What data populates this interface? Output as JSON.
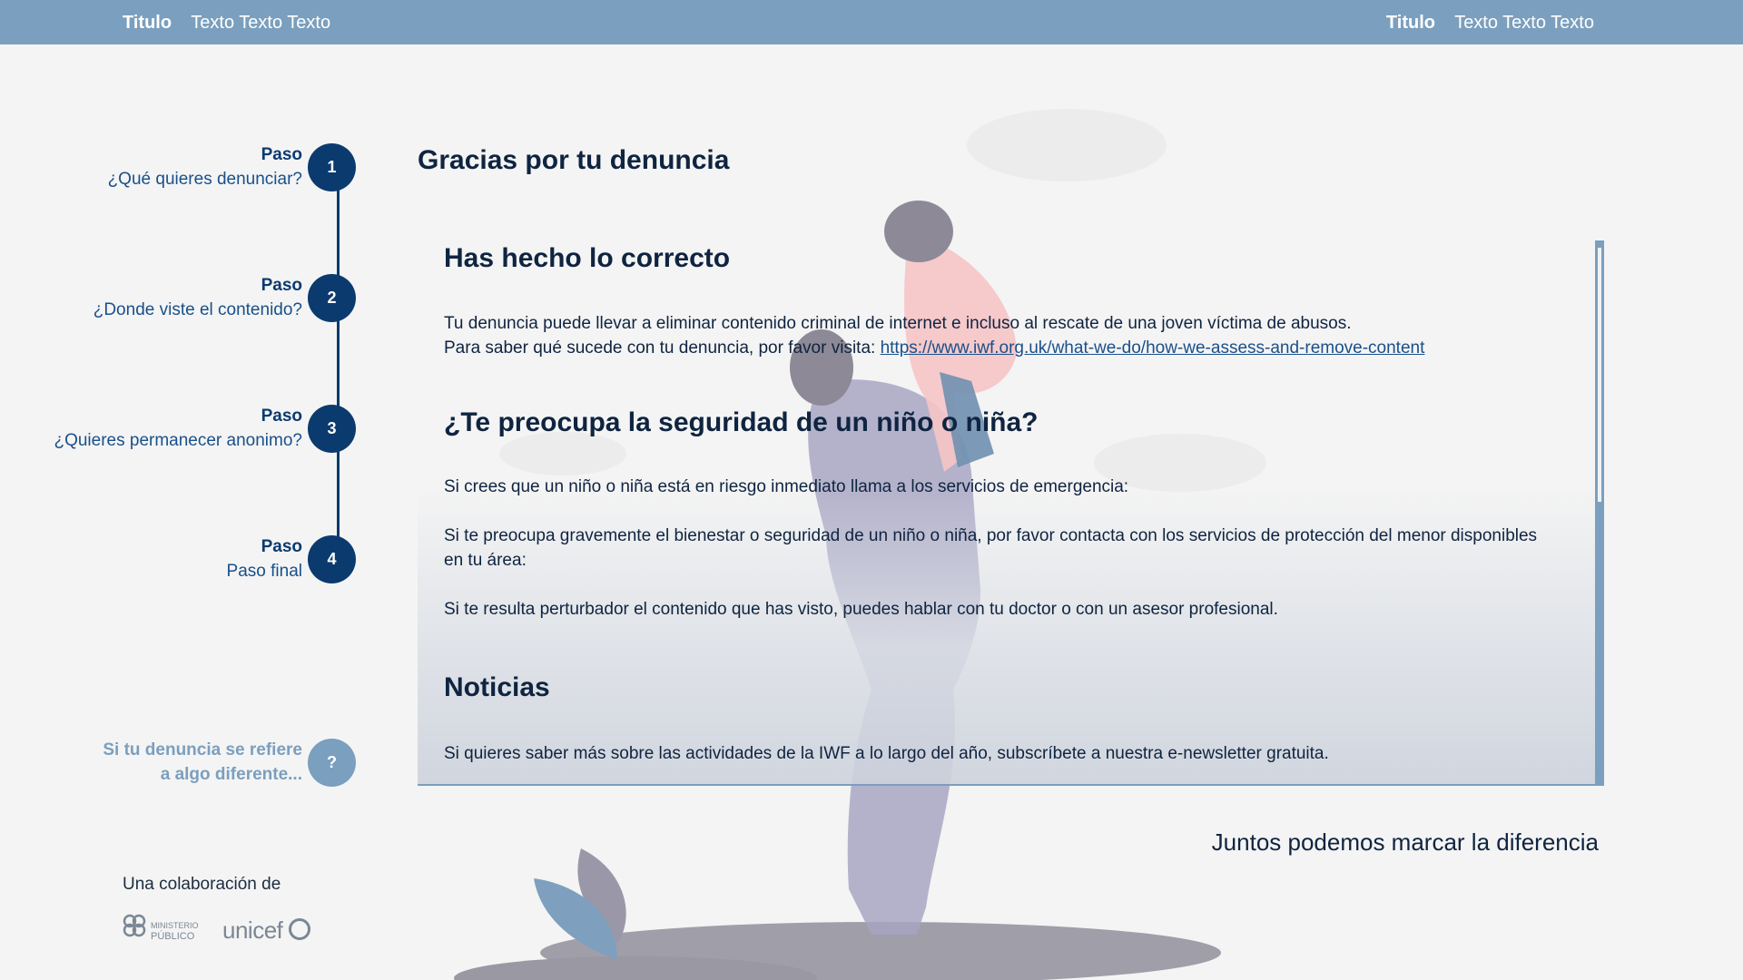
{
  "topbar": {
    "left": {
      "title": "Titulo",
      "text": "Texto Texto Texto"
    },
    "right": {
      "title": "Titulo",
      "text": "Texto Texto Texto"
    }
  },
  "steps": [
    {
      "kicker": "Paso",
      "label": "¿Qué quieres denunciar?",
      "number": "1"
    },
    {
      "kicker": "Paso",
      "label": "¿Donde viste el contenido?",
      "number": "2"
    },
    {
      "kicker": "Paso",
      "label": "¿Quieres permanecer anonimo?",
      "number": "3"
    },
    {
      "kicker": "Paso",
      "label": "Paso final",
      "number": "4"
    }
  ],
  "help": {
    "line1": "Si tu denuncia se refiere",
    "line2": "a algo diferente...",
    "symbol": "?"
  },
  "collaboration": {
    "label": "Una colaboración de",
    "mp_line1": "MINISTERIO",
    "mp_line2": "PÚBLICO",
    "unicef": "unicef"
  },
  "main": {
    "title": "Gracias por tu denuncia",
    "sections": {
      "correct_heading": "Has hecho lo correcto",
      "correct_text1": "Tu denuncia puede llevar a eliminar contenido criminal de internet e incluso al rescate de una joven víctima de abusos.",
      "correct_text2_prefix": "Para saber qué sucede con tu denuncia, por favor visita: ",
      "correct_link": "https://www.iwf.org.uk/what-we-do/how-we-assess-and-remove-content",
      "safety_heading": "¿Te preocupa la seguridad de un niño o niña?",
      "safety_text1": "Si crees que un niño o niña está en riesgo inmediato llama a los servicios de emergencia:",
      "safety_text2": "Si te preocupa gravemente el bienestar o seguridad de un niño o niña, por favor contacta con los servicios de protección del menor disponibles en tu área:",
      "safety_text3": "Si te resulta perturbador el contenido que has visto, puedes hablar con tu doctor o con un asesor profesional.",
      "news_heading": "Noticias",
      "news_text": "Si quieres saber más sobre las actividades de la IWF a lo largo del año, subscríbete a nuestra e-newsletter gratuita."
    },
    "tagline": "Juntos podemos marcar la diferencia"
  },
  "colors": {
    "topbar": "#7b9fbe",
    "primary": "#0b3a6e",
    "help": "#7b9fbe",
    "background": "#f4f4f4"
  }
}
